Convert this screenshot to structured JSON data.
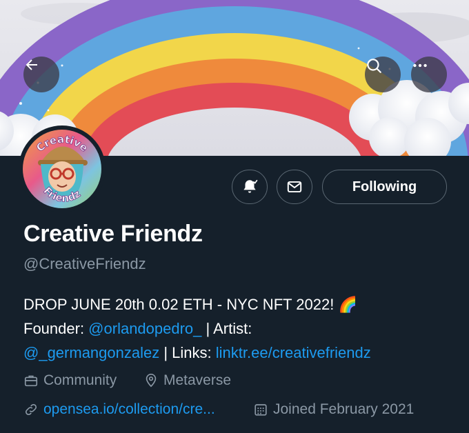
{
  "colors": {
    "background": "#15202b",
    "text": "#ffffff",
    "muted": "#8b98a5",
    "link": "#1d9bf0",
    "border": "#5a6772"
  },
  "header": {
    "back_icon": "arrow-left-icon",
    "search_icon": "search-icon",
    "more_icon": "more-horizontal-icon"
  },
  "avatar": {
    "text_top": "Creative",
    "text_bottom": "Friendz"
  },
  "actions": {
    "notify_icon": "bell-check-icon",
    "message_icon": "envelope-icon",
    "following_label": "Following"
  },
  "profile": {
    "name": "Creative Friendz",
    "handle": "@CreativeFriendz",
    "bio": {
      "line1": "DROP JUNE 20th 0.02 ETH - NYC NFT 2022! ",
      "emoji": "🌈",
      "founder_prefix": "Founder: ",
      "founder_link": "@orlandopedro_",
      "artist_prefix": " | Artist: ",
      "artist_link": "@_germangonzalez",
      "links_prefix": " | Links: ",
      "links_link": "linktr.ee/creativefriendz"
    },
    "meta": {
      "category": "Community",
      "location": "Metaverse",
      "website": "opensea.io/collection/cre...",
      "joined": "Joined February 2021"
    }
  }
}
